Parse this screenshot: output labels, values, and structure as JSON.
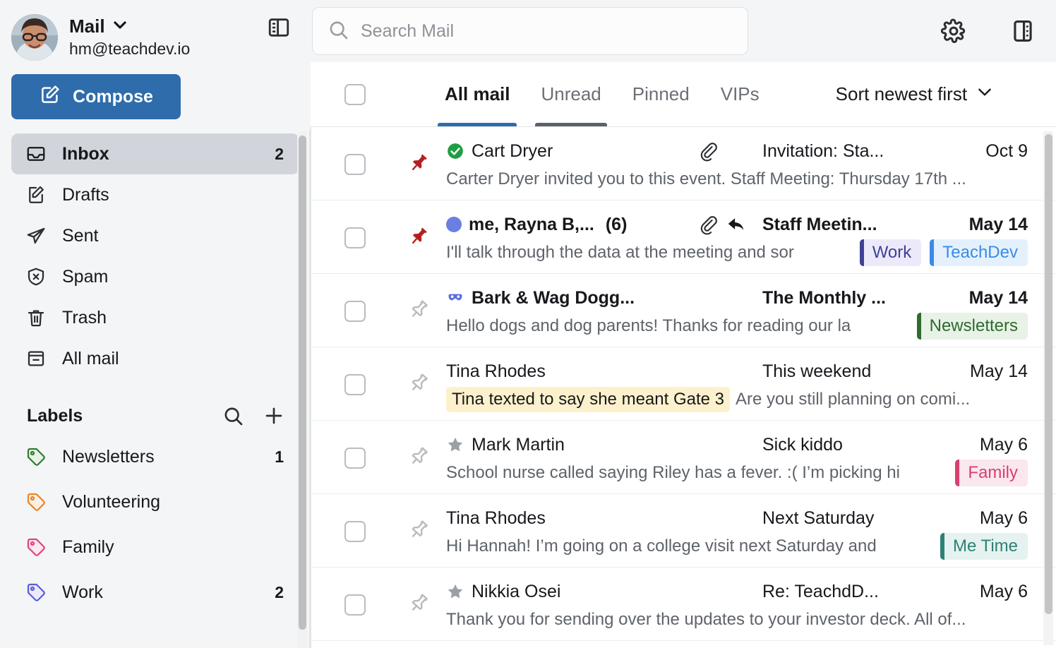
{
  "account": {
    "app_name": "Mail",
    "email": "hm@teachdev.io",
    "chevron_icon": "chevron-down-icon",
    "avatar_icon": "avatar",
    "panel_toggle_icon": "panel-layout-icon"
  },
  "compose": {
    "label": "Compose",
    "icon": "compose-pencil-icon"
  },
  "folders": [
    {
      "label": "Inbox",
      "count": "2",
      "icon": "inbox-icon",
      "active": true
    },
    {
      "label": "Drafts",
      "count": "",
      "icon": "drafts-icon",
      "active": false
    },
    {
      "label": "Sent",
      "count": "",
      "icon": "sent-icon",
      "active": false
    },
    {
      "label": "Spam",
      "count": "",
      "icon": "spam-icon",
      "active": false
    },
    {
      "label": "Trash",
      "count": "",
      "icon": "trash-icon",
      "active": false
    },
    {
      "label": "All mail",
      "count": "",
      "icon": "all-mail-icon",
      "active": false
    }
  ],
  "labels_section": {
    "title": "Labels",
    "search_icon": "search-icon",
    "add_icon": "plus-icon",
    "items": [
      {
        "name": "Newsletters",
        "count": "1",
        "color": "#2e7d32"
      },
      {
        "name": "Volunteering",
        "count": "",
        "color": "#e8862a"
      },
      {
        "name": "Family",
        "count": "",
        "color": "#e0457b"
      },
      {
        "name": "Work",
        "count": "2",
        "color": "#5b5fd6"
      }
    ]
  },
  "search": {
    "placeholder": "Search Mail",
    "value": "",
    "icon": "search-icon"
  },
  "topbar": {
    "settings_icon": "gear-icon",
    "panel_icon": "panel-layout-icon"
  },
  "tabs": [
    {
      "label": "All mail",
      "state": "active"
    },
    {
      "label": "Unread",
      "state": "hovered"
    },
    {
      "label": "Pinned",
      "state": "normal"
    },
    {
      "label": "VIPs",
      "state": "normal"
    }
  ],
  "sort": {
    "label": "Sort newest first",
    "icon": "chevron-down-icon"
  },
  "messages": [
    {
      "sender": "Cart Dryer",
      "sender_bold": false,
      "badge": "verified-check-icon",
      "unread": false,
      "thread_count": "",
      "attachment": true,
      "replied": false,
      "subject": "Invitation: Sta...",
      "subject_bold": false,
      "date": "Oct 9",
      "date_bold": false,
      "preview": "Carter Dryer invited you to this event. Staff Meeting: Thursday 17th ...",
      "note": "",
      "pinned": true,
      "chips": []
    },
    {
      "sender": "me, Rayna B,...",
      "sender_bold": true,
      "badge": "",
      "unread": true,
      "thread_count": "(6)",
      "attachment": true,
      "replied": true,
      "subject": "Staff Meetin...",
      "subject_bold": true,
      "date": "May 14",
      "date_bold": true,
      "preview": "I'll talk through the data at the meeting and sor",
      "note": "",
      "pinned": true,
      "chips": [
        {
          "label": "Work",
          "color": "#3f4196",
          "bg": "#eceafa"
        },
        {
          "label": "TeachDev",
          "color": "#3b8ae8",
          "bg": "#e4f1fd"
        }
      ]
    },
    {
      "sender": "Bark & Wag Dogg...",
      "sender_bold": true,
      "badge": "mask-icon",
      "unread": false,
      "thread_count": "",
      "attachment": false,
      "replied": false,
      "subject": "The Monthly ...",
      "subject_bold": true,
      "date": "May 14",
      "date_bold": true,
      "preview": "Hello dogs and dog parents! Thanks for reading our la",
      "note": "",
      "pinned": false,
      "chips": [
        {
          "label": "Newsletters",
          "color": "#2e6b2f",
          "bg": "#e8f2e6"
        }
      ]
    },
    {
      "sender": "Tina Rhodes",
      "sender_bold": false,
      "badge": "",
      "unread": false,
      "thread_count": "",
      "attachment": false,
      "replied": false,
      "subject": "This weekend",
      "subject_bold": false,
      "date": "May 14",
      "date_bold": false,
      "preview": "Are you still planning on comi...",
      "note": "Tina texted to say she meant Gate 3",
      "pinned": false,
      "chips": []
    },
    {
      "sender": "Mark Martin",
      "sender_bold": false,
      "badge": "star-icon",
      "unread": false,
      "thread_count": "",
      "attachment": false,
      "replied": false,
      "subject": "Sick kiddo",
      "subject_bold": false,
      "date": "May 6",
      "date_bold": false,
      "preview": "School nurse called saying Riley has a fever. :( I’m picking hi",
      "note": "",
      "pinned": false,
      "chips": [
        {
          "label": "Family",
          "color": "#d9406f",
          "bg": "#fbe7ee"
        }
      ]
    },
    {
      "sender": "Tina Rhodes",
      "sender_bold": false,
      "badge": "",
      "unread": false,
      "thread_count": "",
      "attachment": false,
      "replied": false,
      "subject": "Next Saturday",
      "subject_bold": false,
      "date": "May 6",
      "date_bold": false,
      "preview": "Hi Hannah! I’m going on a college visit next Saturday and",
      "note": "",
      "pinned": false,
      "chips": [
        {
          "label": "Me Time",
          "color": "#2e8176",
          "bg": "#e5f2ef"
        }
      ]
    },
    {
      "sender": "Nikkia Osei",
      "sender_bold": false,
      "badge": "star-icon",
      "unread": false,
      "thread_count": "",
      "attachment": false,
      "replied": false,
      "subject": "Re: TeachdD...",
      "subject_bold": false,
      "date": "May 6",
      "date_bold": false,
      "preview": "Thank you for sending over the updates to your investor deck. All of...",
      "note": "",
      "pinned": false,
      "chips": []
    }
  ],
  "colors": {
    "accent": "#2f6cab",
    "pin_active": "#b32020",
    "pin_inactive": "#b9bbbe",
    "unread_dot": "#6a7fe0",
    "verified_green": "#1e9e42",
    "sidebar_bg": "#f4f5f6",
    "active_folder_bg": "#d1d5db"
  }
}
